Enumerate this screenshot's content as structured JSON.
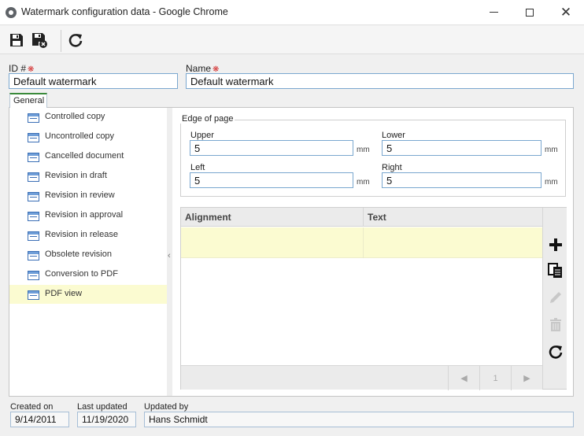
{
  "window": {
    "title": "Watermark configuration data - Google Chrome",
    "controls": {
      "minimize": "minimize",
      "maximize": "maximize",
      "close": "✕"
    }
  },
  "toolbar": {
    "buttons": [
      {
        "icon": "save-icon"
      },
      {
        "icon": "save-and-close-icon"
      },
      {
        "icon": "refresh-icon"
      }
    ]
  },
  "form": {
    "id_label": "ID #",
    "id_value": "Default watermark",
    "name_label": "Name",
    "name_value": "Default watermark",
    "required_mark": "❋"
  },
  "tabs": [
    {
      "label": "General"
    }
  ],
  "sidebar": {
    "items": [
      {
        "label": "Controlled copy"
      },
      {
        "label": "Uncontrolled copy"
      },
      {
        "label": "Cancelled document"
      },
      {
        "label": "Revision in draft"
      },
      {
        "label": "Revision in review"
      },
      {
        "label": "Revision in approval"
      },
      {
        "label": "Revision in release"
      },
      {
        "label": "Obsolete revision"
      },
      {
        "label": "Conversion to PDF"
      },
      {
        "label": "PDF view"
      }
    ],
    "selected_index": 9,
    "collapse_glyph": "‹"
  },
  "edge": {
    "legend": "Edge of page",
    "unit": "mm",
    "upper": {
      "label": "Upper",
      "value": "5"
    },
    "lower": {
      "label": "Lower",
      "value": "5"
    },
    "left": {
      "label": "Left",
      "value": "5"
    },
    "right": {
      "label": "Right",
      "value": "5"
    }
  },
  "grid": {
    "columns": [
      "Alignment",
      "Text"
    ],
    "rows": [
      [
        "",
        ""
      ]
    ],
    "pager": {
      "prev": "◀",
      "page": "1",
      "next": "▶"
    },
    "actions": [
      {
        "icon": "add-icon",
        "enabled": true
      },
      {
        "icon": "copy-icon",
        "enabled": true
      },
      {
        "icon": "edit-icon",
        "enabled": false
      },
      {
        "icon": "delete-icon",
        "enabled": false
      },
      {
        "icon": "refresh-icon",
        "enabled": true
      }
    ]
  },
  "footer": {
    "created_label": "Created on",
    "created_value": "9/14/2011",
    "updated_label": "Last updated",
    "updated_value": "11/19/2020",
    "updated_by_label": "Updated by",
    "updated_by_value": "Hans Schmidt"
  },
  "colors": {
    "selected_row": "#fbfbd1",
    "input_border": "#7aa7cf",
    "required": "#d32f2f",
    "tab_accent": "#3a8a3a"
  }
}
